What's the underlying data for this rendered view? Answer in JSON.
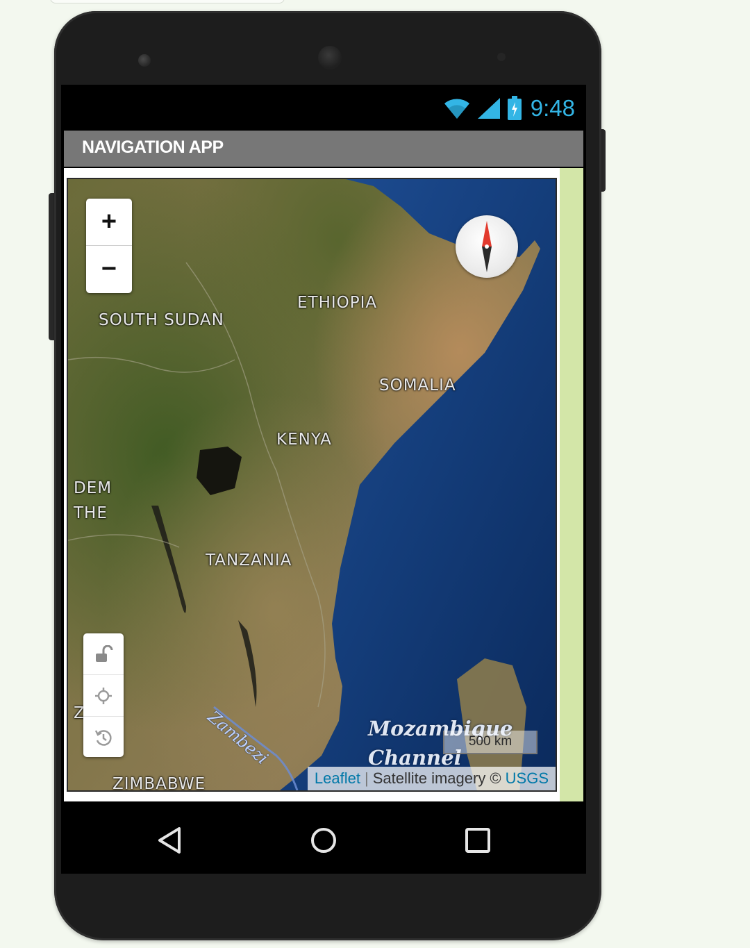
{
  "status_bar": {
    "time": "9:48",
    "icons": [
      "wifi-icon",
      "signal-icon",
      "battery-icon"
    ],
    "accent_color": "#33b5e5"
  },
  "app": {
    "title": "NAVIGATION APP",
    "title_bar_color": "#777777"
  },
  "map": {
    "zoom_in_label": "+",
    "zoom_out_label": "−",
    "country_labels": {
      "south_sudan": "SOUTH SUDAN",
      "ethiopia": "ETHIOPIA",
      "somalia": "SOMALIA",
      "kenya": "KENYA",
      "dem": "DEM",
      "the": "THE",
      "tanzania": "TANZANIA",
      "zambia": "Z         IA",
      "zimbabwe": "ZIMBABWE"
    },
    "water_labels": {
      "mozambique_channel_1": "Mozambique",
      "mozambique_channel_2": "Channel",
      "zambezi": "Zambezi"
    },
    "scale_label": "500 km",
    "attribution": {
      "leaflet": "Leaflet",
      "separator": "|",
      "imagery": "Satellite imagery ©",
      "usgs": "USGS"
    },
    "tools": [
      "lock-icon",
      "locate-icon",
      "history-icon"
    ],
    "compass": "compass-icon"
  },
  "nav_bar": {
    "buttons": [
      "back-icon",
      "home-icon",
      "recent-apps-icon"
    ]
  }
}
